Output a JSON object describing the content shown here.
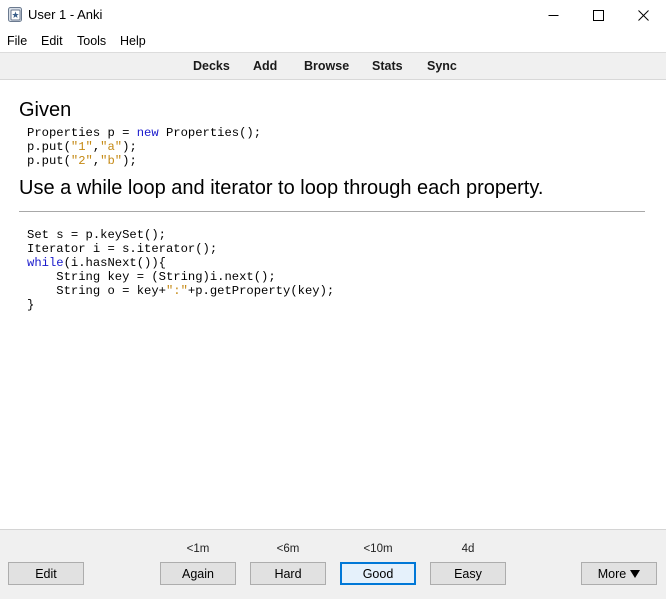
{
  "window": {
    "title": "User 1 - Anki",
    "icon": "anki-star-icon",
    "controls": [
      "minimize-icon",
      "maximize-icon",
      "close-icon"
    ]
  },
  "menu": {
    "file": "File",
    "edit": "Edit",
    "tools": "Tools",
    "help": "Help"
  },
  "toolbar": {
    "decks": "Decks",
    "add": "Add",
    "browse": "Browse",
    "stats": "Stats",
    "sync": "Sync"
  },
  "card": {
    "front_heading": "Given",
    "front_code": [
      [
        {
          "t": "Properties p = "
        },
        {
          "t": "new",
          "c": "kw"
        },
        {
          "t": " Properties();"
        }
      ],
      [
        {
          "t": "p.put("
        },
        {
          "t": "\"1\"",
          "c": "str"
        },
        {
          "t": ","
        },
        {
          "t": "\"a\"",
          "c": "str"
        },
        {
          "t": ");"
        }
      ],
      [
        {
          "t": "p.put("
        },
        {
          "t": "\"2\"",
          "c": "str"
        },
        {
          "t": ","
        },
        {
          "t": "\"b\"",
          "c": "str"
        },
        {
          "t": ");"
        }
      ]
    ],
    "question": "Use a while loop and iterator to loop through each property.",
    "answer_code": [
      [
        {
          "t": "Set s = p.keySet();"
        }
      ],
      [
        {
          "t": "Iterator i = s.iterator();"
        }
      ],
      [
        {
          "t": "while",
          "c": "kw"
        },
        {
          "t": "(i.hasNext()){"
        }
      ],
      [
        {
          "t": "    String key = (String)i.next();"
        }
      ],
      [
        {
          "t": "    String o = key+"
        },
        {
          "t": "\":\"",
          "c": "str"
        },
        {
          "t": "+p.getProperty(key);"
        }
      ],
      [
        {
          "t": "}"
        }
      ]
    ]
  },
  "bottom": {
    "edit": "Edit",
    "more": "More",
    "answers": [
      {
        "interval": "<1m",
        "label": "Again"
      },
      {
        "interval": "<6m",
        "label": "Hard"
      },
      {
        "interval": "<10m",
        "label": "Good",
        "default": true
      },
      {
        "interval": "4d",
        "label": "Easy"
      }
    ]
  },
  "colors": {
    "keyword": "#1a1acc",
    "string": "#c58a16",
    "default_button_border": "#0078d7"
  }
}
